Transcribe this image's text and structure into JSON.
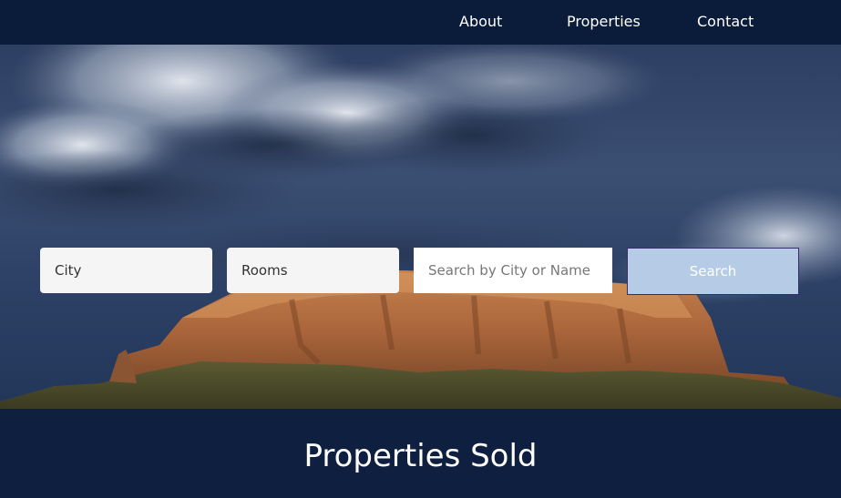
{
  "nav": {
    "about": "About",
    "properties": "Properties",
    "contact": "Contact"
  },
  "search": {
    "city": "City",
    "rooms": "Rooms",
    "query_placeholder": "Search by City or Name",
    "button": "Search"
  },
  "sold": {
    "title": "Properties Sold"
  },
  "colors": {
    "nav_bg": "#0b1b3a",
    "button_bg": "#b6cce6",
    "section_bg": "#0f1f3f"
  }
}
